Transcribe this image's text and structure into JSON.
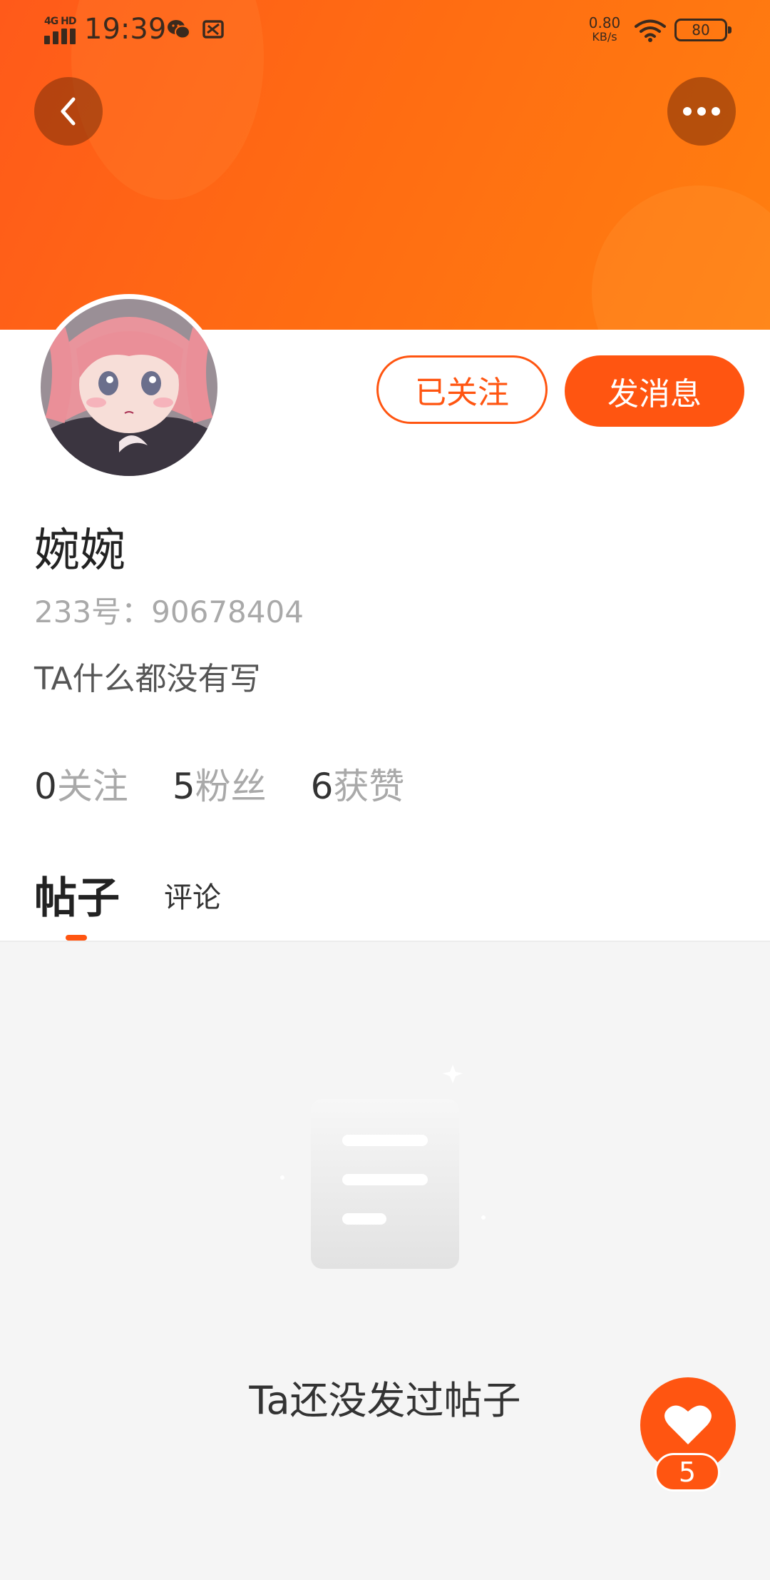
{
  "status_bar": {
    "network": "4G HD",
    "time": "19:39",
    "speed_value": "0.80",
    "speed_unit": "KB/s",
    "battery": "80"
  },
  "header": {
    "back_icon": "chevron-left-icon",
    "more_icon": "more-horizontal-icon"
  },
  "profile": {
    "name": "婉婉",
    "id_text": "233号：90678404",
    "bio": "TA什么都没有写",
    "follow_button": "已关注",
    "message_button": "发消息"
  },
  "stats": [
    {
      "value": "0",
      "label": "关注"
    },
    {
      "value": "5",
      "label": "粉丝"
    },
    {
      "value": "6",
      "label": "获赞"
    }
  ],
  "tabs": {
    "posts": "帖子",
    "comments": "评论"
  },
  "empty_state": {
    "icon": "document-icon",
    "text": "Ta还没发过帖子"
  },
  "fab": {
    "icon": "heart-icon",
    "count": "5"
  },
  "colors": {
    "accent": "#ff5511",
    "header_gradient_start": "#ff5a1a",
    "header_gradient_end": "#ff7f10"
  }
}
